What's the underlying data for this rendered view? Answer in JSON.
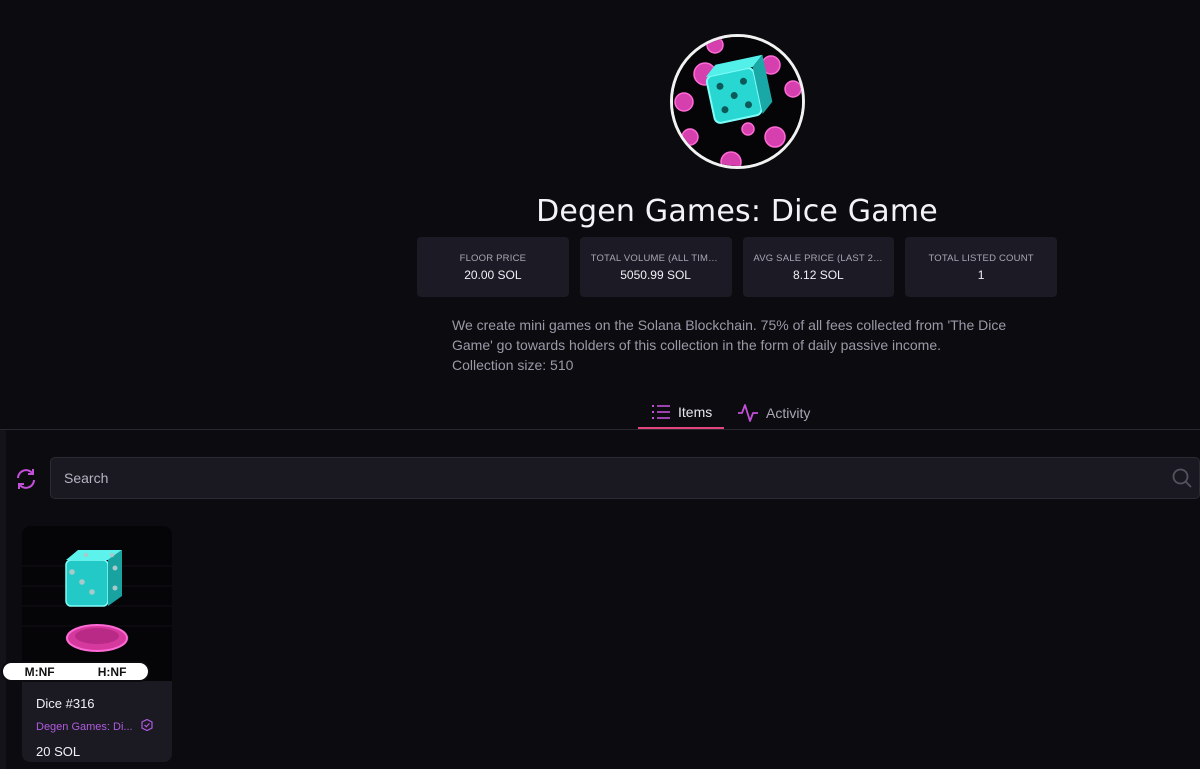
{
  "collection": {
    "title": "Degen Games: Dice Game",
    "description": "We create mini games on the Solana Blockchain. 75% of all fees collected from 'The Dice Game' go towards holders of this collection in the form of daily passive income.",
    "size_text": "Collection size: 510"
  },
  "stats": [
    {
      "label": "FLOOR PRICE",
      "value": "20.00 SOL"
    },
    {
      "label": "TOTAL VOLUME (ALL TIME...",
      "value": "5050.99 SOL"
    },
    {
      "label": "AVG SALE PRICE (LAST 24...",
      "value": "8.12 SOL"
    },
    {
      "label": "TOTAL LISTED COUNT",
      "value": "1"
    }
  ],
  "tabs": [
    {
      "label": "Items",
      "icon": "list-icon",
      "active": true
    },
    {
      "label": "Activity",
      "icon": "activity-icon",
      "active": false
    }
  ],
  "search": {
    "placeholder": "Search",
    "value": ""
  },
  "items": [
    {
      "name": "Dice #316",
      "collection": "Degen Games: Di...",
      "price": "20 SOL",
      "rank_m": "M:NF",
      "rank_h": "H:NF"
    }
  ],
  "colors": {
    "background": "#0c0b10",
    "accent": "#b05be0",
    "tab_underline": "#e0457b",
    "dice": "#2fe6e0",
    "dot_pink": "#e048b8"
  }
}
